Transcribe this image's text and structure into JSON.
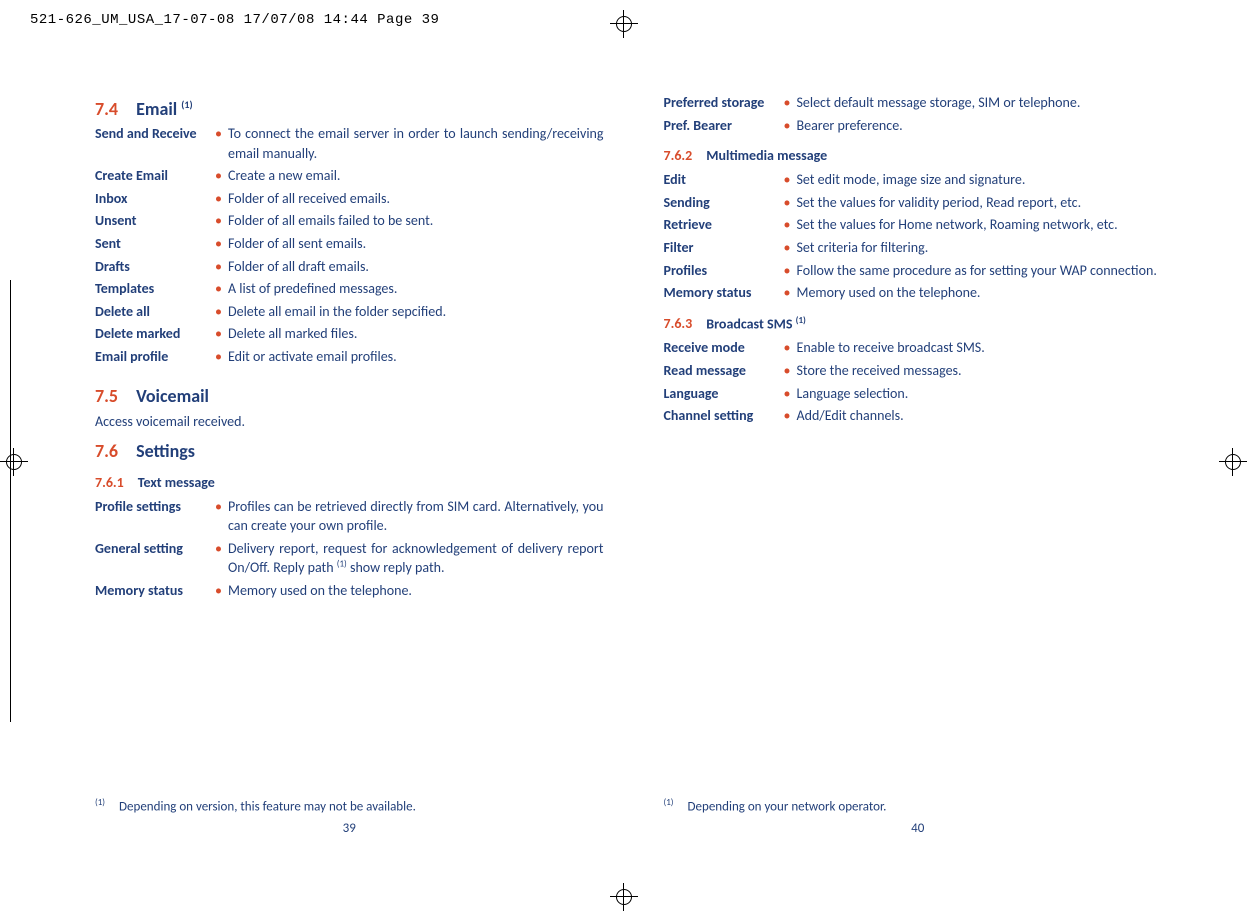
{
  "header": "521-626_UM_USA_17-07-08  17/07/08  14:44  Page 39",
  "left": {
    "s74": {
      "num": "7.4",
      "title": "Email",
      "sup": "(1)"
    },
    "rows74": [
      {
        "term": "Send and Receive",
        "desc": "To connect the email server in order to launch sending/receiving email manually.",
        "justify": true
      },
      {
        "term": "Create Email",
        "desc": "Create a new email."
      },
      {
        "term": "Inbox",
        "desc": "Folder of all received emails."
      },
      {
        "term": "Unsent",
        "desc": "Folder of all emails failed to be sent."
      },
      {
        "term": "Sent",
        "desc": "Folder of all sent emails."
      },
      {
        "term": "Drafts",
        "desc": "Folder of all draft emails."
      },
      {
        "term": "Templates",
        "desc": "A list of predefined messages."
      },
      {
        "term": "Delete all",
        "desc": "Delete all email in the folder sepcified."
      },
      {
        "term": "Delete marked",
        "desc": "Delete all marked files."
      },
      {
        "term": "Email profile",
        "desc": "Edit or activate email profiles."
      }
    ],
    "s75": {
      "num": "7.5",
      "title": "Voicemail"
    },
    "s75_body": "Access voicemail received.",
    "s76": {
      "num": "7.6",
      "title": "Settings"
    },
    "s761": {
      "num": "7.6.1",
      "title": "Text message"
    },
    "rows761": [
      {
        "term": "Profile settings",
        "desc": "Profiles can be retrieved directly from SIM card. Alternatively, you can create your own profile.",
        "justify": true
      },
      {
        "term": "General setting",
        "desc": "Delivery report, request for acknowledgement of delivery report On/Off. Reply path",
        "sup": "(1)",
        "desc2": " show reply path.",
        "justify": true
      },
      {
        "term": "Memory status",
        "desc": "Memory used on the telephone."
      }
    ],
    "footnote": {
      "sup": "(1)",
      "text": "Depending on version, this feature may not be available."
    },
    "pagenum": "39"
  },
  "right": {
    "rows_top": [
      {
        "term": "Preferred storage",
        "desc": "Select default message storage, SIM or telephone."
      },
      {
        "term": "Pref. Bearer",
        "desc": "Bearer preference."
      }
    ],
    "s762": {
      "num": "7.6.2",
      "title": "Multimedia message"
    },
    "rows762": [
      {
        "term": "Edit",
        "desc": "Set edit mode, image size and signature."
      },
      {
        "term": "Sending",
        "desc": "Set the values for validity period, Read report, etc."
      },
      {
        "term": "Retrieve",
        "desc": "Set the values for Home network, Roaming network, etc.",
        "justify": true
      },
      {
        "term": "Filter",
        "desc": "Set criteria for filtering."
      },
      {
        "term": "Profiles",
        "desc": "Follow the same procedure as for setting your WAP connection."
      },
      {
        "term": "Memory status",
        "desc": "Memory used on the telephone."
      }
    ],
    "s763": {
      "num": "7.6.3",
      "title": "Broadcast SMS",
      "sup": "(1)"
    },
    "rows763": [
      {
        "term": "Receive mode",
        "desc": "Enable to receive broadcast SMS."
      },
      {
        "term": "Read message",
        "desc": "Store the received messages."
      },
      {
        "term": "Language",
        "desc": "Language selection."
      },
      {
        "term": "Channel setting",
        "desc": "Add/Edit channels."
      }
    ],
    "footnote": {
      "sup": "(1)",
      "text": "Depending on your network operator."
    },
    "pagenum": "40"
  }
}
